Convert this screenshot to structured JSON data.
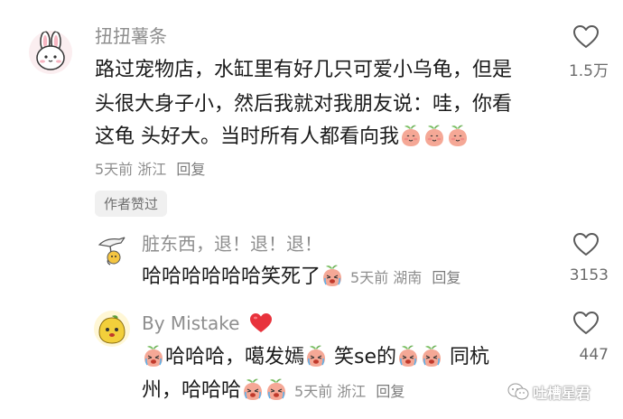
{
  "comments": [
    {
      "username": "扭扭薯条",
      "lines": [
        "路过宠物店，水缸里有好几只可爱小乌龟，但是",
        "头很大身子小，然后我就对我朋友说：哇，你看",
        "这龟 头好大。当时所有人都看向我"
      ],
      "time": "5天前",
      "location": "浙江",
      "reply": "回复",
      "likes": "1.5万",
      "badge": "作者赞过"
    },
    {
      "username": "脏东西，退！退！退！",
      "text": "哈哈哈哈哈哈笑死了",
      "time": "5天前",
      "location": "湖南",
      "reply": "回复",
      "likes": "3153"
    },
    {
      "username": "By Mistake",
      "line1_a": "哈哈哈，噶发嫣",
      "line1_b": "笑se的",
      "line1_c": "同杭",
      "line2": "州，哈哈哈",
      "time": "5天前",
      "location": "浙江",
      "reply": "回复",
      "likes": "447"
    }
  ],
  "watermark": "吐槽星君",
  "icons": {
    "like": "heart-outline-icon",
    "emoji_peach": "peach-face-emoji",
    "emoji_cry": "crying-face-emoji",
    "heart": "red-heart-emoji"
  },
  "colors": {
    "username": "#8e8e8e",
    "text": "#1a1a1a",
    "heart": "#e8323c"
  }
}
